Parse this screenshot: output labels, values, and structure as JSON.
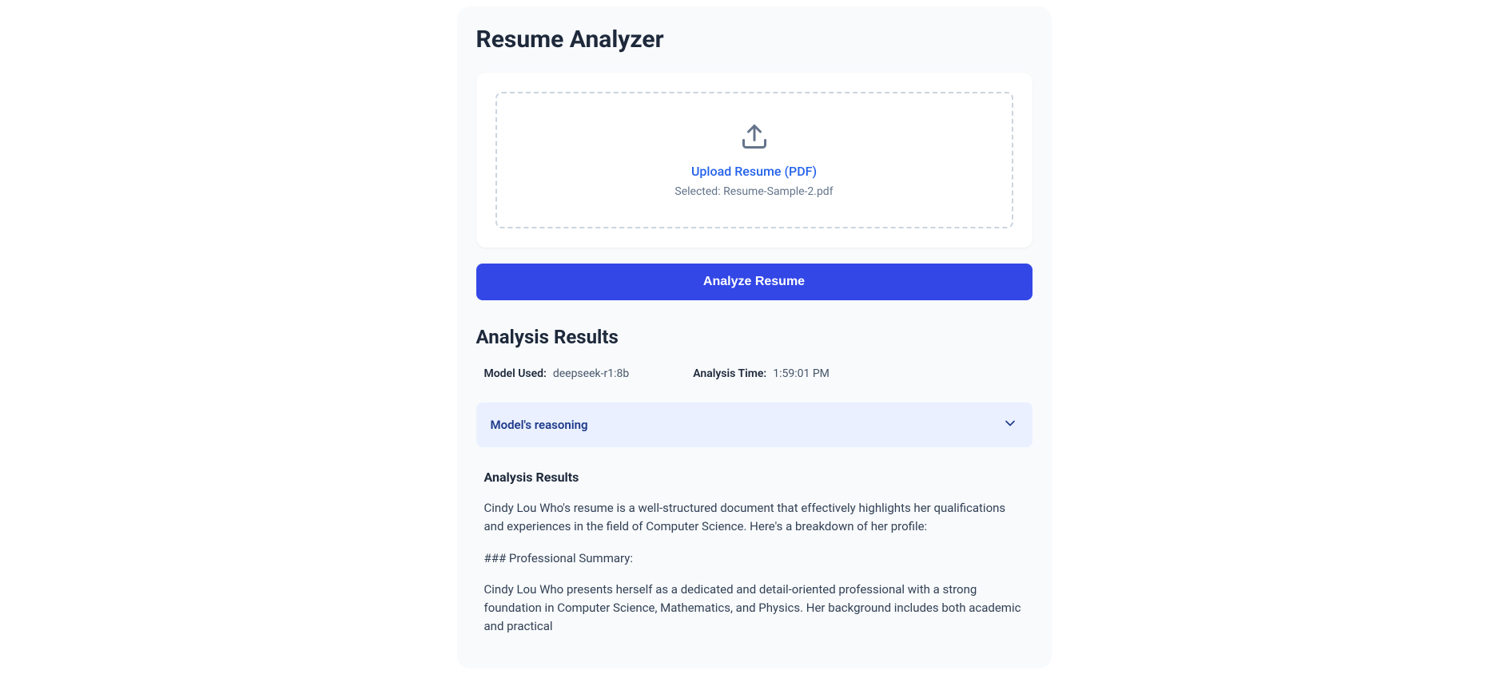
{
  "header": {
    "title": "Resume Analyzer"
  },
  "upload": {
    "link_text": "Upload Resume (PDF)",
    "selected_prefix": "Selected: ",
    "selected_file": "Resume-Sample-2.pdf"
  },
  "actions": {
    "analyze_label": "Analyze Resume"
  },
  "results": {
    "heading": "Analysis Results",
    "meta": {
      "model_label": "Model Used:",
      "model_value": "deepseek-r1:8b",
      "time_label": "Analysis Time:",
      "time_value": "1:59:01 PM"
    },
    "reasoning": {
      "label": "Model's reasoning"
    },
    "body": {
      "subheading": "Analysis Results",
      "p1": "Cindy Lou Who's resume is a well-structured document that effectively highlights her qualifications and experiences in the field of Computer Science. Here's a breakdown of her profile:",
      "p2": "### Professional Summary:",
      "p3": "Cindy Lou Who presents herself as a dedicated and detail-oriented professional with a strong foundation in Computer Science, Mathematics, and Physics. Her background includes both academic and practical"
    }
  }
}
